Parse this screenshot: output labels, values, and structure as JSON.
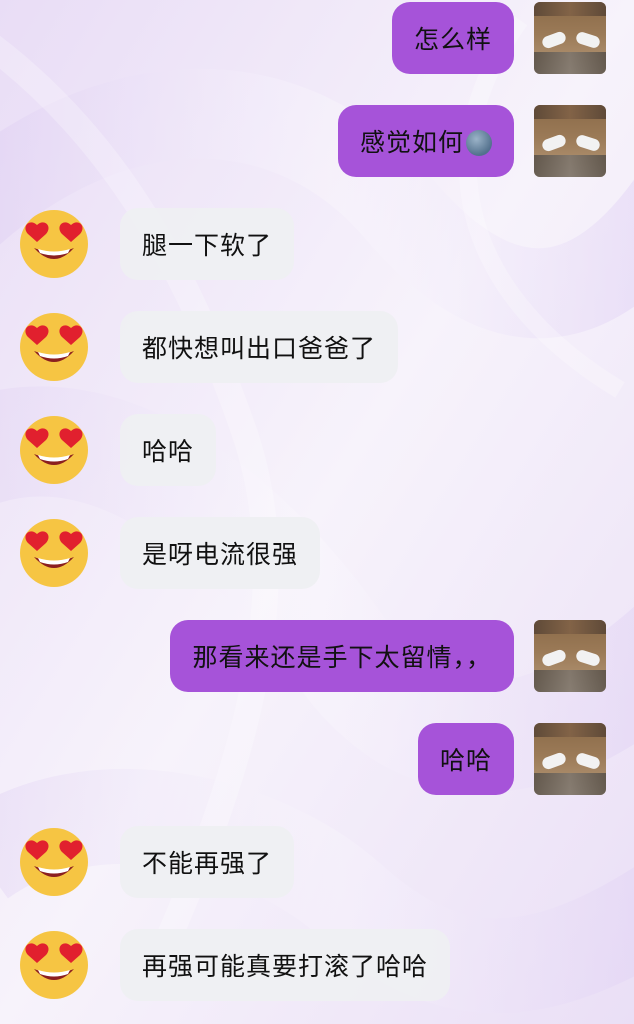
{
  "messages": [
    {
      "side": "right",
      "text": "怎么样",
      "avatar": "photo-avatar",
      "emoji": null
    },
    {
      "side": "right",
      "text": "感觉如何",
      "avatar": "photo-avatar",
      "emoji": "new-moon-face-icon"
    },
    {
      "side": "left",
      "text": "腿一下软了",
      "avatar": "heart-eyes-emoji",
      "emoji": null
    },
    {
      "side": "left",
      "text": "都快想叫出口爸爸了",
      "avatar": "heart-eyes-emoji",
      "emoji": null
    },
    {
      "side": "left",
      "text": "哈哈",
      "avatar": "heart-eyes-emoji",
      "emoji": null
    },
    {
      "side": "left",
      "text": "是呀电流很强",
      "avatar": "heart-eyes-emoji",
      "emoji": null
    },
    {
      "side": "right",
      "text": "那看来还是手下太留情，，",
      "avatar": "photo-avatar",
      "emoji": null
    },
    {
      "side": "right",
      "text": "哈哈",
      "avatar": "photo-avatar",
      "emoji": null
    },
    {
      "side": "left",
      "text": "不能再强了",
      "avatar": "heart-eyes-emoji",
      "emoji": null
    },
    {
      "side": "left",
      "text": "再强可能真要打滚了哈哈",
      "avatar": "heart-eyes-emoji",
      "emoji": null
    }
  ],
  "colors": {
    "outgoing_bubble": "#a653d9",
    "incoming_bubble": "#eeeff3",
    "text": "#111111"
  }
}
